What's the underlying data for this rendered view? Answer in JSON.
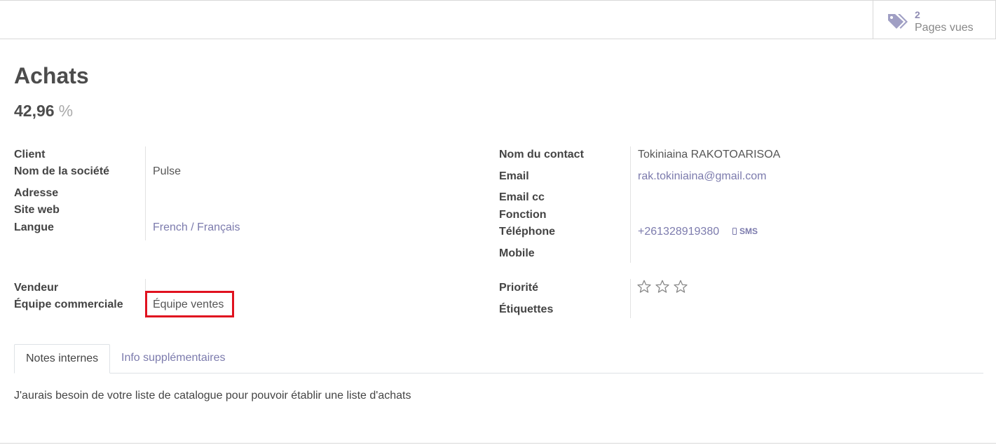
{
  "stat_button": {
    "value": "2",
    "label": "Pages vues",
    "icon": "tags-icon"
  },
  "record": {
    "title": "Achats",
    "probability": "42,96",
    "probability_unit": "%"
  },
  "left_fields": {
    "client_label": "Client",
    "company_label": "Nom de la société",
    "company_value": "Pulse",
    "address_label": "Adresse",
    "website_label": "Site web",
    "language_label": "Langue",
    "language_value": "French / Français",
    "salesperson_label": "Vendeur",
    "team_label": "Équipe commerciale",
    "team_value": "Équipe ventes"
  },
  "right_fields": {
    "contact_label": "Nom du contact",
    "contact_value": "Tokiniaina RAKOTOARISOA",
    "email_label": "Email",
    "email_value": "rak.tokiniaina@gmail.com",
    "email_cc_label": "Email cc",
    "function_label": "Fonction",
    "phone_label": "Téléphone",
    "phone_value": "+261328919380",
    "sms_label": "SMS",
    "mobile_label": "Mobile",
    "priority_label": "Priorité",
    "priority_value": 0,
    "priority_max": 3,
    "tags_label": "Étiquettes"
  },
  "tabs": [
    {
      "label": "Notes internes",
      "active": true
    },
    {
      "label": "Info supplémentaires",
      "active": false
    }
  ],
  "notes": {
    "text": "J'aurais besoin de votre liste de catalogue pour pouvoir établir une liste d'achats"
  },
  "colors": {
    "accent": "#7c7bad",
    "highlight": "#e0121f"
  }
}
